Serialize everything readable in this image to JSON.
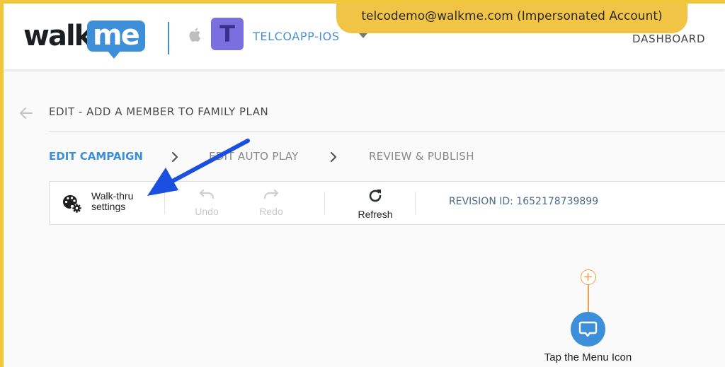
{
  "header": {
    "logo_text_walk": "walk",
    "logo_text_me": "me",
    "app_avatar_letter": "T",
    "app_name": "TELCOAPP-IOS",
    "dashboard_label": "DASHBOARD",
    "impersonation_banner": "telcodemo@walkme.com (Impersonated Account)"
  },
  "page": {
    "title": "EDIT - ADD A MEMBER TO FAMILY PLAN"
  },
  "steps": [
    {
      "label": "EDIT CAMPAIGN",
      "active": true
    },
    {
      "label": "EDIT AUTO PLAY",
      "active": false
    },
    {
      "label": "REVIEW & PUBLISH",
      "active": false
    }
  ],
  "toolbar": {
    "walkthru_settings_label": "Walk-thru settings",
    "undo_label": "Undo",
    "redo_label": "Redo",
    "refresh_label": "Refresh",
    "revision_label": "REVISION ID: 1652178739899"
  },
  "flow": {
    "node_label": "Tap the Menu Icon"
  },
  "colors": {
    "accent_blue": "#3c8fd8",
    "banner_yellow": "#f2c445",
    "avatar_purple": "#7b6fe0",
    "flow_orange": "#f0a04a",
    "annotation_arrow": "#1a4fe0"
  },
  "icons": {
    "back": "arrow-left-icon",
    "platform": "apple-icon",
    "caret": "caret-down-icon",
    "step_separator": "chevron-right-icon",
    "walkthru_settings": "palette-gear-icon",
    "undo": "undo-icon",
    "redo": "redo-icon",
    "refresh": "refresh-icon",
    "flow_add": "plus-icon",
    "flow_node": "chat-bubble-icon"
  }
}
